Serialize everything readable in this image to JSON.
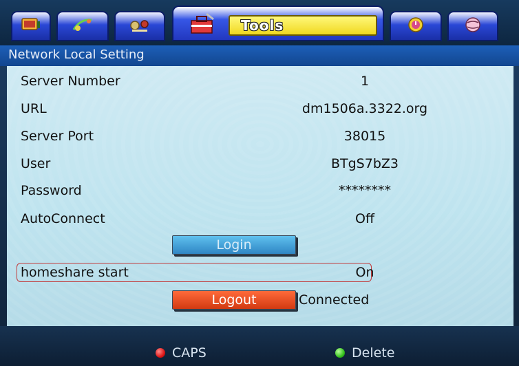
{
  "tabs": {
    "icons": [
      "tv-icon",
      "satellite-icon",
      "tools-settings-icon",
      "toolbox-icon",
      "clock-icon",
      "globe-icon"
    ],
    "active_label": "Tools"
  },
  "section": {
    "title": "Network Local Setting"
  },
  "settings": [
    {
      "label": "Server Number",
      "value": "1"
    },
    {
      "label": "URL",
      "value": "dm1506a.3322.org"
    },
    {
      "label": "Server Port",
      "value": "38015"
    },
    {
      "label": "User",
      "value": "BTgS7bZ3"
    },
    {
      "label": "Password",
      "value": "********"
    },
    {
      "label": "AutoConnect",
      "value": "Off"
    }
  ],
  "login_button": "Login",
  "homeshare": {
    "label": "homeshare start",
    "value": "On"
  },
  "logout_button": "Logout",
  "connection_status": "Connected",
  "footer": {
    "red_hint": "CAPS",
    "green_hint": "Delete"
  },
  "colors": {
    "accent_yellow": "#f0d820",
    "panel_bg": "#c4e6f0",
    "login_blue": "#3a96d2",
    "logout_red": "#e24a1c",
    "focus_outline": "#c23a3a",
    "red_key": "#e01818",
    "green_key": "#36c21e"
  }
}
